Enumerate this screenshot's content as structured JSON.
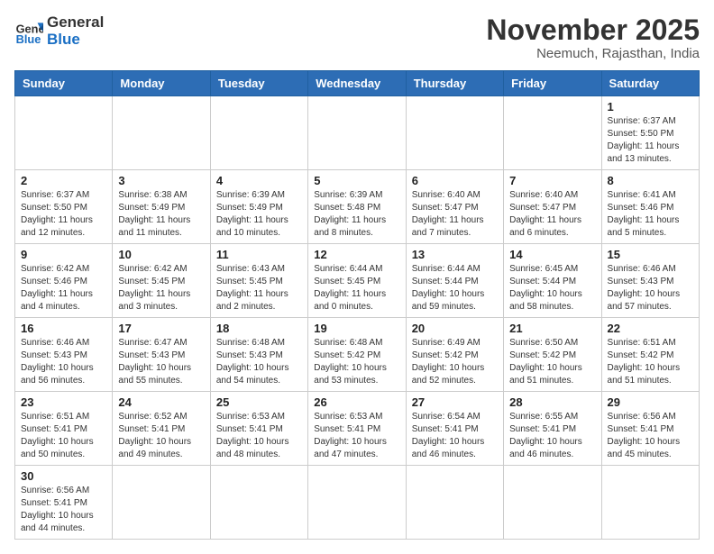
{
  "header": {
    "logo_line1": "General",
    "logo_line2": "Blue",
    "month_title": "November 2025",
    "location": "Neemuch, Rajasthan, India"
  },
  "weekdays": [
    "Sunday",
    "Monday",
    "Tuesday",
    "Wednesday",
    "Thursday",
    "Friday",
    "Saturday"
  ],
  "weeks": [
    [
      {
        "day": "",
        "info": ""
      },
      {
        "day": "",
        "info": ""
      },
      {
        "day": "",
        "info": ""
      },
      {
        "day": "",
        "info": ""
      },
      {
        "day": "",
        "info": ""
      },
      {
        "day": "",
        "info": ""
      },
      {
        "day": "1",
        "info": "Sunrise: 6:37 AM\nSunset: 5:50 PM\nDaylight: 11 hours\nand 13 minutes."
      }
    ],
    [
      {
        "day": "2",
        "info": "Sunrise: 6:37 AM\nSunset: 5:50 PM\nDaylight: 11 hours\nand 12 minutes."
      },
      {
        "day": "3",
        "info": "Sunrise: 6:38 AM\nSunset: 5:49 PM\nDaylight: 11 hours\nand 11 minutes."
      },
      {
        "day": "4",
        "info": "Sunrise: 6:39 AM\nSunset: 5:49 PM\nDaylight: 11 hours\nand 10 minutes."
      },
      {
        "day": "5",
        "info": "Sunrise: 6:39 AM\nSunset: 5:48 PM\nDaylight: 11 hours\nand 8 minutes."
      },
      {
        "day": "6",
        "info": "Sunrise: 6:40 AM\nSunset: 5:47 PM\nDaylight: 11 hours\nand 7 minutes."
      },
      {
        "day": "7",
        "info": "Sunrise: 6:40 AM\nSunset: 5:47 PM\nDaylight: 11 hours\nand 6 minutes."
      },
      {
        "day": "8",
        "info": "Sunrise: 6:41 AM\nSunset: 5:46 PM\nDaylight: 11 hours\nand 5 minutes."
      }
    ],
    [
      {
        "day": "9",
        "info": "Sunrise: 6:42 AM\nSunset: 5:46 PM\nDaylight: 11 hours\nand 4 minutes."
      },
      {
        "day": "10",
        "info": "Sunrise: 6:42 AM\nSunset: 5:45 PM\nDaylight: 11 hours\nand 3 minutes."
      },
      {
        "day": "11",
        "info": "Sunrise: 6:43 AM\nSunset: 5:45 PM\nDaylight: 11 hours\nand 2 minutes."
      },
      {
        "day": "12",
        "info": "Sunrise: 6:44 AM\nSunset: 5:45 PM\nDaylight: 11 hours\nand 0 minutes."
      },
      {
        "day": "13",
        "info": "Sunrise: 6:44 AM\nSunset: 5:44 PM\nDaylight: 10 hours\nand 59 minutes."
      },
      {
        "day": "14",
        "info": "Sunrise: 6:45 AM\nSunset: 5:44 PM\nDaylight: 10 hours\nand 58 minutes."
      },
      {
        "day": "15",
        "info": "Sunrise: 6:46 AM\nSunset: 5:43 PM\nDaylight: 10 hours\nand 57 minutes."
      }
    ],
    [
      {
        "day": "16",
        "info": "Sunrise: 6:46 AM\nSunset: 5:43 PM\nDaylight: 10 hours\nand 56 minutes."
      },
      {
        "day": "17",
        "info": "Sunrise: 6:47 AM\nSunset: 5:43 PM\nDaylight: 10 hours\nand 55 minutes."
      },
      {
        "day": "18",
        "info": "Sunrise: 6:48 AM\nSunset: 5:43 PM\nDaylight: 10 hours\nand 54 minutes."
      },
      {
        "day": "19",
        "info": "Sunrise: 6:48 AM\nSunset: 5:42 PM\nDaylight: 10 hours\nand 53 minutes."
      },
      {
        "day": "20",
        "info": "Sunrise: 6:49 AM\nSunset: 5:42 PM\nDaylight: 10 hours\nand 52 minutes."
      },
      {
        "day": "21",
        "info": "Sunrise: 6:50 AM\nSunset: 5:42 PM\nDaylight: 10 hours\nand 51 minutes."
      },
      {
        "day": "22",
        "info": "Sunrise: 6:51 AM\nSunset: 5:42 PM\nDaylight: 10 hours\nand 51 minutes."
      }
    ],
    [
      {
        "day": "23",
        "info": "Sunrise: 6:51 AM\nSunset: 5:41 PM\nDaylight: 10 hours\nand 50 minutes."
      },
      {
        "day": "24",
        "info": "Sunrise: 6:52 AM\nSunset: 5:41 PM\nDaylight: 10 hours\nand 49 minutes."
      },
      {
        "day": "25",
        "info": "Sunrise: 6:53 AM\nSunset: 5:41 PM\nDaylight: 10 hours\nand 48 minutes."
      },
      {
        "day": "26",
        "info": "Sunrise: 6:53 AM\nSunset: 5:41 PM\nDaylight: 10 hours\nand 47 minutes."
      },
      {
        "day": "27",
        "info": "Sunrise: 6:54 AM\nSunset: 5:41 PM\nDaylight: 10 hours\nand 46 minutes."
      },
      {
        "day": "28",
        "info": "Sunrise: 6:55 AM\nSunset: 5:41 PM\nDaylight: 10 hours\nand 46 minutes."
      },
      {
        "day": "29",
        "info": "Sunrise: 6:56 AM\nSunset: 5:41 PM\nDaylight: 10 hours\nand 45 minutes."
      }
    ],
    [
      {
        "day": "30",
        "info": "Sunrise: 6:56 AM\nSunset: 5:41 PM\nDaylight: 10 hours\nand 44 minutes."
      },
      {
        "day": "",
        "info": ""
      },
      {
        "day": "",
        "info": ""
      },
      {
        "day": "",
        "info": ""
      },
      {
        "day": "",
        "info": ""
      },
      {
        "day": "",
        "info": ""
      },
      {
        "day": "",
        "info": ""
      }
    ]
  ]
}
